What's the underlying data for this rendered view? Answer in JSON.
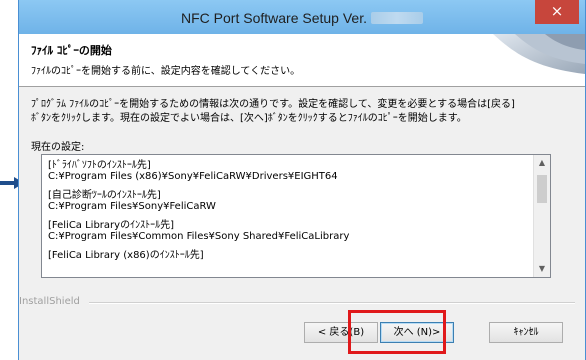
{
  "window": {
    "title": "NFC Port Software Setup  Ver.",
    "close_label": "×"
  },
  "header": {
    "title": "ﾌｧｲﾙ ｺﾋﾟｰの開始",
    "subtitle": "ﾌｧｲﾙのｺﾋﾟｰを開始する前に、設定内容を確認してください。"
  },
  "body": {
    "description_line1": "ﾌﾟﾛｸﾞﾗﾑ ﾌｧｲﾙのｺﾋﾟｰを開始するための情報は次の通りです。設定を確認して、変更を必要とする場合は[戻る]",
    "description_line2": "ﾎﾞﾀﾝをｸﾘｯｸします。現在の設定でよい場合は、[次へ]ﾎﾞﾀﾝをｸﾘｯｸするとﾌｧｲﾙのｺﾋﾟｰを開始します。",
    "settings_label": "現在の設定:"
  },
  "settings_list": [
    {
      "heading": "[ﾄﾞﾗｲﾊﾞｿﾌﾄのｲﾝｽﾄｰﾙ先]",
      "path": "C:¥Program Files (x86)¥Sony¥FeliCaRW¥Drivers¥EIGHT64"
    },
    {
      "heading": "[自己診断ﾂｰﾙのｲﾝｽﾄｰﾙ先]",
      "path": "C:¥Program Files¥Sony¥FeliCaRW"
    },
    {
      "heading": "[FeliCa Libraryのｲﾝｽﾄｰﾙ先]",
      "path": "C:¥Program Files¥Common Files¥Sony Shared¥FeliCaLibrary"
    },
    {
      "heading": "[FeliCa Library (x86)のｲﾝｽﾄｰﾙ先]",
      "path": ""
    }
  ],
  "footer": {
    "brand": "InstallShield",
    "back_label": "< 戻る(B)",
    "next_label": "次へ (N)>",
    "cancel_label": "ｷｬﾝｾﾙ"
  },
  "colors": {
    "highlight": "#e0191b",
    "close": "#c7463c",
    "arrow": "#1f4e8c"
  }
}
